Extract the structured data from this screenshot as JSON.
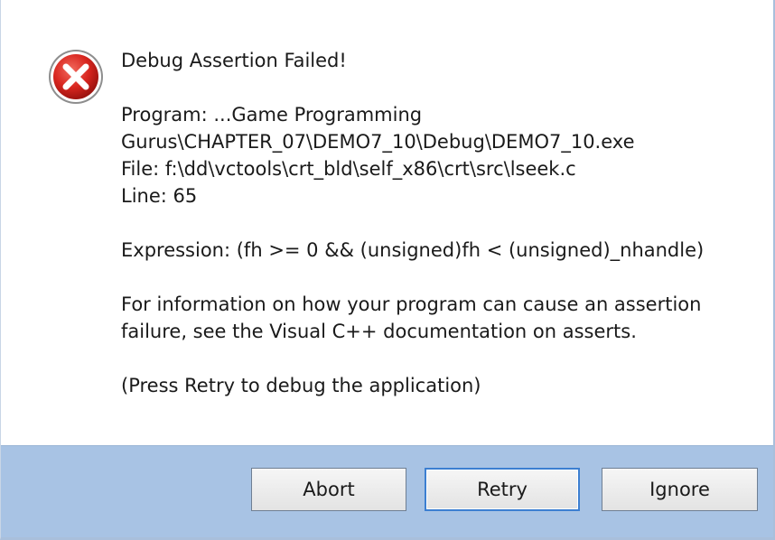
{
  "dialog": {
    "title_line": "Debug Assertion Failed!",
    "program_line_1": "Program: ...Game Programming",
    "program_line_2": "Gurus\\CHAPTER_07\\DEMO7_10\\Debug\\DEMO7_10.exe",
    "file_line": "File: f:\\dd\\vctools\\crt_bld\\self_x86\\crt\\src\\lseek.c",
    "line_line": "Line: 65",
    "expression_line": "Expression: (fh >= 0 && (unsigned)fh < (unsigned)_nhandle)",
    "info_line_1": "For information on how your program can cause an assertion",
    "info_line_2": "failure, see the Visual C++ documentation on asserts.",
    "press_line": "(Press Retry to debug the application)",
    "icon": "error-icon"
  },
  "buttons": {
    "abort_label": "Abort",
    "retry_label": "Retry",
    "ignore_label": "Ignore"
  },
  "colors": {
    "button_bar": "#a8c3e4",
    "error_red": "#d8261f",
    "default_button_border": "#3c7fd1"
  }
}
